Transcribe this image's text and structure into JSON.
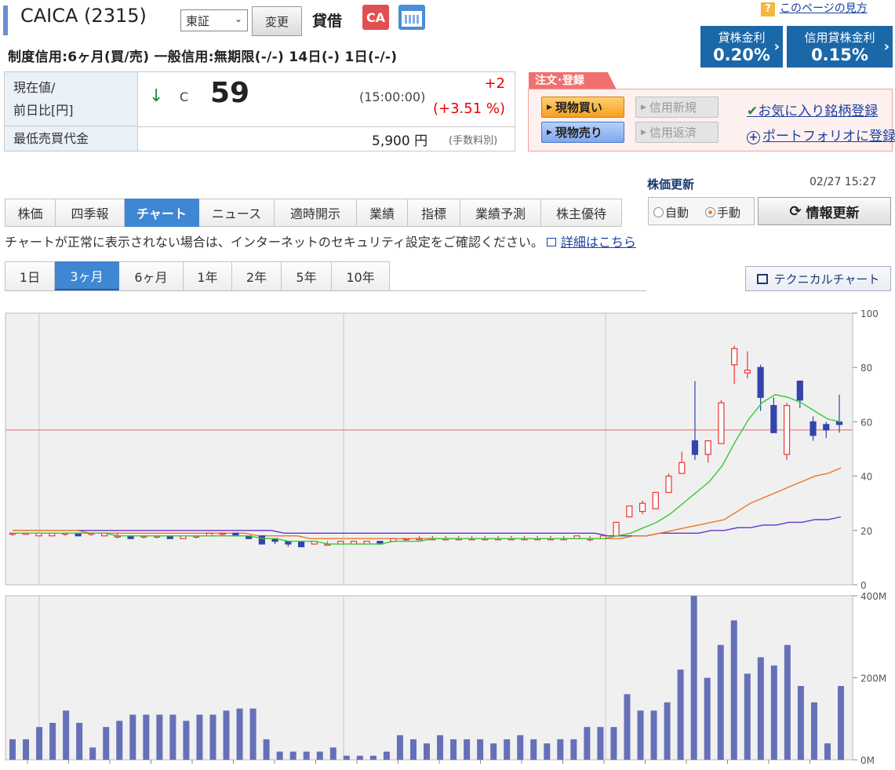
{
  "header": {
    "stock_name": "CAICA (2315)",
    "market": "東証",
    "change_label": "変更",
    "taishaku": "貸借",
    "ca_icon": "CA",
    "help_link": "このページの見方",
    "help_icon": "?"
  },
  "rates": {
    "lend_label": "貸株金利",
    "lend_value": "0.20%",
    "credit_lend_label": "信用貸株金利",
    "credit_lend_value": "0.15%"
  },
  "credit_line": "制度信用:6ヶ月(買/売) 一般信用:無期限(-/-) 14日(-) 1日(-/-)",
  "quote": {
    "current_label_1": "現在値/",
    "current_label_2": "前日比[円]",
    "arrow": "↓",
    "mark": "C",
    "price": "59",
    "time": "(15:00:00)",
    "change": "+2",
    "change_pct": "(+3.51 %)",
    "min_label": "最低売買代金",
    "min_value": "5,900 円",
    "fee_note": "(手数料別)"
  },
  "order": {
    "tab_label": "注文･登録",
    "buy": "現物買い",
    "sell": "現物売り",
    "margin_new": "信用新規",
    "margin_close": "信用返済",
    "favorite": "お気に入り銘柄登録",
    "portfolio": "ポートフォリオに登録"
  },
  "update": {
    "title": "株価更新",
    "time": "02/27 15:27",
    "auto": "自動",
    "manual": "手動",
    "refresh": "情報更新"
  },
  "tabs": [
    "株価",
    "四季報",
    "チャート",
    "ニュース",
    "適時開示",
    "業績",
    "指標",
    "業績予測",
    "株主優待"
  ],
  "notice": {
    "text": "チャートが正常に表示されない場合は、インターネットのセキュリティ設定をご確認ください。",
    "link": "詳細はこちら"
  },
  "period_tabs": [
    "1日",
    "3ヶ月",
    "6ヶ月",
    "1年",
    "2年",
    "5年",
    "10年"
  ],
  "tech_chart_label": "テクニカルチャート",
  "colors": {
    "up": "#ee3333",
    "down": "#3344aa",
    "ma_short": "#33cc33",
    "ma_mid": "#ee7722",
    "ma_long": "#6633cc",
    "volume": "#6670b8",
    "ref_line": "#f08080"
  },
  "chart_data": {
    "type": "candlestick",
    "price_axis": {
      "ticks": [
        0,
        20,
        40,
        60,
        80,
        100
      ],
      "ylim": [
        0,
        100
      ]
    },
    "volume_axis": {
      "ticks": [
        "0M",
        "200M",
        "400M"
      ],
      "ylim": [
        0,
        400
      ]
    },
    "reference_line": 57,
    "candles": [
      [
        19,
        19,
        18,
        19
      ],
      [
        19,
        19,
        19,
        19
      ],
      [
        18,
        19,
        18,
        19
      ],
      [
        18,
        19,
        18,
        19
      ],
      [
        19,
        19,
        18,
        19
      ],
      [
        19,
        19,
        18,
        18
      ],
      [
        19,
        19,
        18,
        19
      ],
      [
        18,
        19,
        18,
        19
      ],
      [
        18,
        19,
        17,
        18
      ],
      [
        18,
        18,
        17,
        17
      ],
      [
        18,
        18,
        17,
        18
      ],
      [
        18,
        18,
        17,
        18
      ],
      [
        18,
        18,
        17,
        17
      ],
      [
        17,
        18,
        17,
        18
      ],
      [
        18,
        18,
        17,
        18
      ],
      [
        18,
        19,
        18,
        19
      ],
      [
        19,
        19,
        18,
        19
      ],
      [
        19,
        19,
        18,
        18
      ],
      [
        18,
        18,
        17,
        17
      ],
      [
        18,
        18,
        15,
        15
      ],
      [
        17,
        17,
        15,
        16
      ],
      [
        16,
        16,
        14,
        15
      ],
      [
        16,
        16,
        14,
        14
      ],
      [
        15,
        16,
        15,
        16
      ],
      [
        15,
        16,
        15,
        15
      ],
      [
        15,
        16,
        15,
        16
      ],
      [
        15,
        16,
        15,
        16
      ],
      [
        15,
        16,
        15,
        16
      ],
      [
        16,
        16,
        15,
        15
      ],
      [
        16,
        17,
        16,
        17
      ],
      [
        17,
        17,
        16,
        17
      ],
      [
        17,
        18,
        17,
        17
      ],
      [
        17,
        18,
        17,
        17
      ],
      [
        17,
        18,
        17,
        17
      ],
      [
        17,
        18,
        17,
        17
      ],
      [
        17,
        18,
        17,
        17
      ],
      [
        17,
        18,
        17,
        17
      ],
      [
        17,
        18,
        17,
        17
      ],
      [
        17,
        18,
        17,
        17
      ],
      [
        17,
        18,
        17,
        17
      ],
      [
        17,
        18,
        17,
        17
      ],
      [
        17,
        18,
        17,
        17
      ],
      [
        17,
        18,
        17,
        17
      ],
      [
        17,
        18,
        17,
        18
      ],
      [
        17,
        18,
        16,
        17
      ],
      [
        17,
        18,
        17,
        18
      ],
      [
        18,
        23,
        18,
        23
      ],
      [
        25,
        29,
        25,
        29
      ],
      [
        27,
        31,
        26,
        30
      ],
      [
        28,
        34,
        28,
        34
      ],
      [
        34,
        41,
        34,
        40
      ],
      [
        41,
        49,
        41,
        45
      ],
      [
        53,
        75,
        46,
        48
      ],
      [
        48,
        52,
        45,
        53
      ],
      [
        52,
        68,
        52,
        67
      ],
      [
        81,
        88,
        74,
        87
      ],
      [
        78,
        86,
        76,
        79
      ],
      [
        80,
        81,
        64,
        69
      ],
      [
        66,
        69,
        56,
        56
      ],
      [
        48,
        67,
        46,
        66
      ],
      [
        75,
        75,
        65,
        68
      ],
      [
        60,
        62,
        53,
        55
      ],
      [
        59,
        60,
        54,
        57
      ],
      [
        60,
        70,
        56,
        59
      ]
    ],
    "ma_short": [
      19,
      19,
      19,
      19,
      19,
      19,
      19,
      19,
      18,
      18,
      18,
      18,
      18,
      18,
      18,
      18,
      18,
      18,
      18,
      17,
      17,
      16,
      16,
      16,
      15,
      15,
      15,
      15,
      15,
      16,
      16,
      16,
      17,
      17,
      17,
      17,
      17,
      17,
      17,
      17,
      17,
      17,
      17,
      17,
      17,
      17,
      18,
      19,
      21,
      23,
      26,
      30,
      34,
      38,
      44,
      53,
      61,
      67,
      70,
      69,
      67,
      64,
      61,
      60
    ],
    "ma_mid": [
      20,
      20,
      20,
      20,
      20,
      20,
      19,
      19,
      19,
      19,
      19,
      19,
      19,
      19,
      19,
      19,
      19,
      19,
      19,
      18,
      18,
      18,
      18,
      17,
      17,
      17,
      17,
      17,
      17,
      17,
      17,
      17,
      17,
      17,
      17,
      17,
      17,
      17,
      17,
      17,
      17,
      17,
      17,
      17,
      17,
      17,
      17,
      17,
      18,
      18,
      19,
      20,
      21,
      22,
      23,
      24,
      27,
      30,
      32,
      34,
      36,
      38,
      40,
      41,
      43
    ],
    "ma_long": [
      20,
      20,
      20,
      20,
      20,
      20,
      20,
      20,
      20,
      20,
      20,
      20,
      20,
      20,
      20,
      20,
      20,
      20,
      20,
      20,
      20,
      19,
      19,
      19,
      19,
      19,
      19,
      19,
      19,
      19,
      19,
      19,
      19,
      19,
      19,
      19,
      19,
      19,
      19,
      19,
      19,
      19,
      19,
      19,
      19,
      19,
      18,
      18,
      18,
      18,
      19,
      19,
      19,
      19,
      20,
      20,
      21,
      21,
      22,
      22,
      23,
      23,
      24,
      24,
      25
    ],
    "volume": [
      50,
      50,
      80,
      90,
      120,
      90,
      30,
      80,
      95,
      110,
      110,
      110,
      110,
      95,
      110,
      110,
      120,
      125,
      125,
      50,
      20,
      20,
      20,
      20,
      30,
      10,
      10,
      10,
      20,
      60,
      50,
      40,
      60,
      50,
      50,
      50,
      40,
      50,
      60,
      50,
      40,
      50,
      50,
      80,
      80,
      80,
      160,
      120,
      120,
      140,
      220,
      400,
      200,
      280,
      340,
      210,
      250,
      230,
      280,
      180,
      140,
      40,
      180
    ],
    "vol_unit": "M"
  }
}
